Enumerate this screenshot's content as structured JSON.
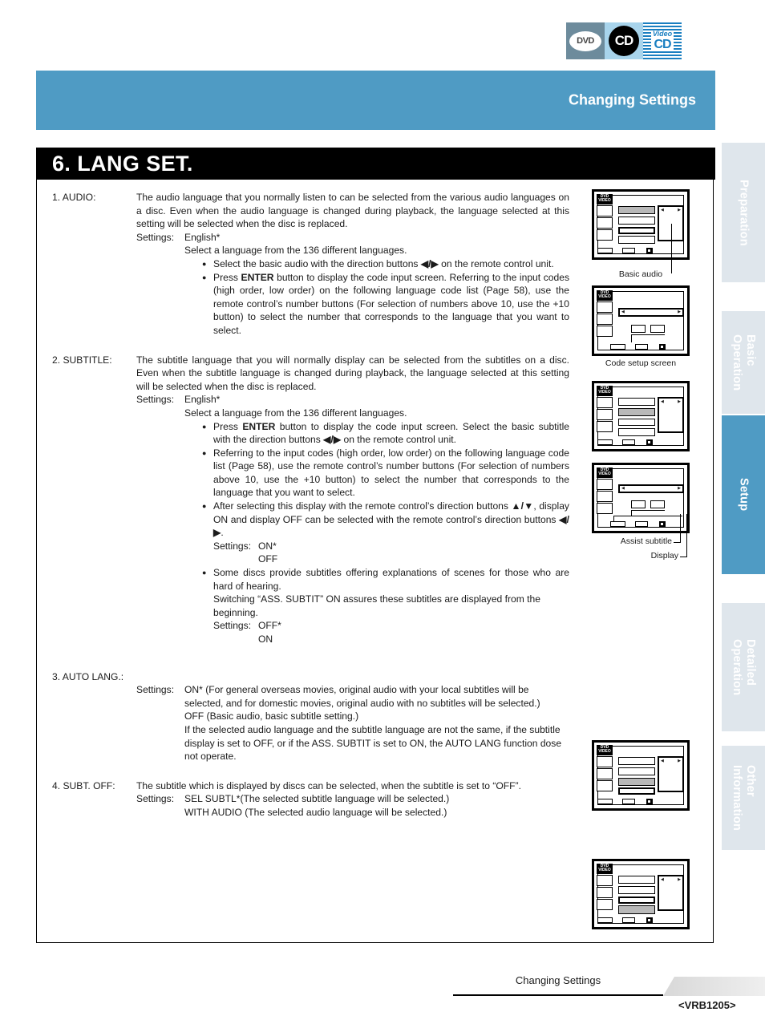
{
  "logos": [
    {
      "name": "dvd-logo",
      "text": "DVD"
    },
    {
      "name": "cd-logo",
      "text": "CD"
    },
    {
      "name": "video-cd-logo",
      "text_top": "Video",
      "text_main": "CD"
    }
  ],
  "header": {
    "title": "Changing Settings"
  },
  "page_title": "6. LANG SET.",
  "sections": {
    "audio": {
      "label": "1. AUDIO:",
      "p1": "The audio language that you normally listen to can be selected from the various audio languages on a disc. Even when the audio language is changed during playback, the language selected at this setting will be selected when the disc is replaced.",
      "settings_key": "Settings:",
      "settings_val": "English*",
      "settings_note": "Select a language from the 136 different languages.",
      "bullets": [
        {
          "pre": "Select the basic audio with the direction buttons ",
          "arrows": "◀/▶",
          "post": " on the remote control unit."
        },
        {
          "pre": "Press ",
          "bold": "ENTER",
          "post": " button to display the code input screen. Referring to the input codes (high order, low order) on the following language code list (Page 58), use the remote control’s number buttons (For selection of numbers above 10, use the +10 button) to select the number that corresponds to the language that you want to select."
        }
      ]
    },
    "subtitle": {
      "label": "2. SUBTITLE:",
      "p1": "The subtitle language that you will normally display can be selected from the subtitles on a disc. Even when the subtitle language is changed during playback, the language selected at this setting will be selected when the disc is replaced.",
      "settings_key": "Settings:",
      "settings_val": "English*",
      "settings_note": "Select a language from the 136 different languages.",
      "b1_pre": "Press ",
      "b1_bold": "ENTER",
      "b1_mid": " button to display the code input screen. Select the basic subtitle with the direction buttons ",
      "b1_arrows": "◀/▶",
      "b1_post": " on the remote control unit.",
      "b2": "Referring to the input codes (high order, low order) on the following language code list (Page 58), use the remote control’s number buttons (For selection of numbers above 10, use the +10 button) to select the number that corresponds to the language that you want to select.",
      "b3_pre": "After selecting this display with the remote control’s direction buttons ",
      "b3_arrows_ud": "▲/▼",
      "b3_mid": ", display ON and display OFF can be selected with the remote control’s  direction buttons ",
      "b3_arrows_lr": "◀/▶",
      "b3_post": ".",
      "b3_settings_key": "Settings:",
      "b3_settings_on": "ON*",
      "b3_settings_off": "OFF",
      "b4_l1": "Some discs provide subtitles offering explanations of scenes for those who are hard of hearing.",
      "b4_l2": "Switching “ASS. SUBTIT” ON assures these subtitles are displayed from the beginning.",
      "b4_settings_key": "Settings:",
      "b4_settings_off": "OFF*",
      "b4_settings_on": "ON"
    },
    "auto_lang": {
      "label": "3. AUTO LANG.:",
      "settings_key": "Settings:",
      "on_line": "ON* (For general overseas movies, original audio with your local subtitles will be selected, and for domestic movies, original audio with no subtitles will be selected.)",
      "off_line": "OFF (Basic audio, basic subtitle setting.)",
      "note": "If the selected audio language and the subtitle language are not the same, if the subtitle display is set to OFF, or if the ASS. SUBTIT is set to ON, the AUTO LANG function dose not operate."
    },
    "subt_off": {
      "label": "4. SUBT. OFF:",
      "p1": "The subtitle which is displayed by discs can be selected, when the subtitle is set to “OFF”.",
      "settings_key": "Settings:",
      "val1": "SEL SUBTL*(The selected subtitle language will be selected.)",
      "val2": "WITH AUDIO (The selected audio language will be selected.)"
    }
  },
  "thumbnails": [
    {
      "name": "screen-basic-audio",
      "caption": "Basic audio"
    },
    {
      "name": "screen-code-setup",
      "caption": "Code setup screen"
    },
    {
      "name": "screen-subtitle",
      "caption": ""
    },
    {
      "name": "screen-assist-subtitle",
      "caption": "Assist subtitle",
      "caption2": "Display"
    },
    {
      "name": "screen-auto-lang",
      "caption": ""
    },
    {
      "name": "screen-subt-off",
      "caption": ""
    }
  ],
  "rail_tabs": [
    {
      "label": "Preparation",
      "active": false
    },
    {
      "label_line1": "Basic",
      "label_line2": "Operation",
      "active": false
    },
    {
      "label": "Setup",
      "active": true
    },
    {
      "label_line1": "Detailed",
      "label_line2": "Operation",
      "active": false
    },
    {
      "label_line1": "Other",
      "label_line2": "Information",
      "active": false
    }
  ],
  "footer": {
    "title": "Changing Settings",
    "code": "<VRB1205>"
  },
  "colors": {
    "accent": "#4f9bc4",
    "tab_inactive": "#dfe6ec",
    "title_bar": "#000000"
  }
}
